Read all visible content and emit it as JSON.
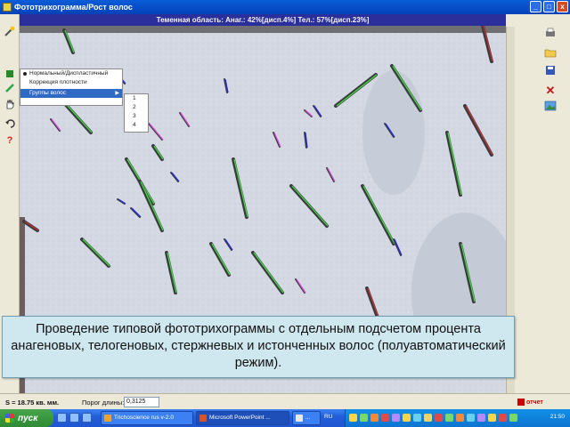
{
  "window": {
    "title": "Фототрихограмма/Рост волос",
    "buttons": [
      "_",
      "□",
      "x"
    ]
  },
  "infobar": {
    "text": "Теменная область: Анаг.: 42%[дисп.4%] Тел.: 57%[дисп.23%]"
  },
  "menu": {
    "items": [
      {
        "label": "Нормальный/Диспластичный",
        "checked": true
      },
      {
        "label": "Коррекция плотности",
        "checked": false
      },
      {
        "label": "Группы волос",
        "selected": true,
        "has_submenu": true
      }
    ],
    "submenu": [
      "1",
      "2",
      "3",
      "4"
    ]
  },
  "caption": {
    "text": "Проведение типовой фототрихограммы с отдельным подсчетом процента анагеновых, телогеновых, стержневых и истонченных волос (полуавтоматический режим)."
  },
  "statusbar": {
    "area": "S = 18.75 кв. мм.",
    "threshold_label": "Порог длины:",
    "threshold_value": "0,3125",
    "report_label": "отчет"
  },
  "taskbar": {
    "start_label": "пуск",
    "tasks": [
      "Trichoscience rus v-2.0",
      "Microsoft PowerPoint ...",
      "..."
    ],
    "lang": "RU",
    "clock": "21:50"
  },
  "icons": {
    "left": [
      "wand-icon",
      "mark-icon",
      "pen-icon",
      "hand-icon",
      "undo-icon",
      "help-icon"
    ],
    "right": [
      "print-icon",
      "open-icon",
      "save-icon",
      "delete-icon",
      "image-icon"
    ]
  },
  "colors": {
    "anagen_line": "#3fdc3f",
    "telogen_line": "#2a2adc",
    "thin_line": "#d94fd9",
    "vellus_line": "#c23030",
    "title_bar": "#0a5cd8",
    "info_bar": "#2a2f9c"
  }
}
